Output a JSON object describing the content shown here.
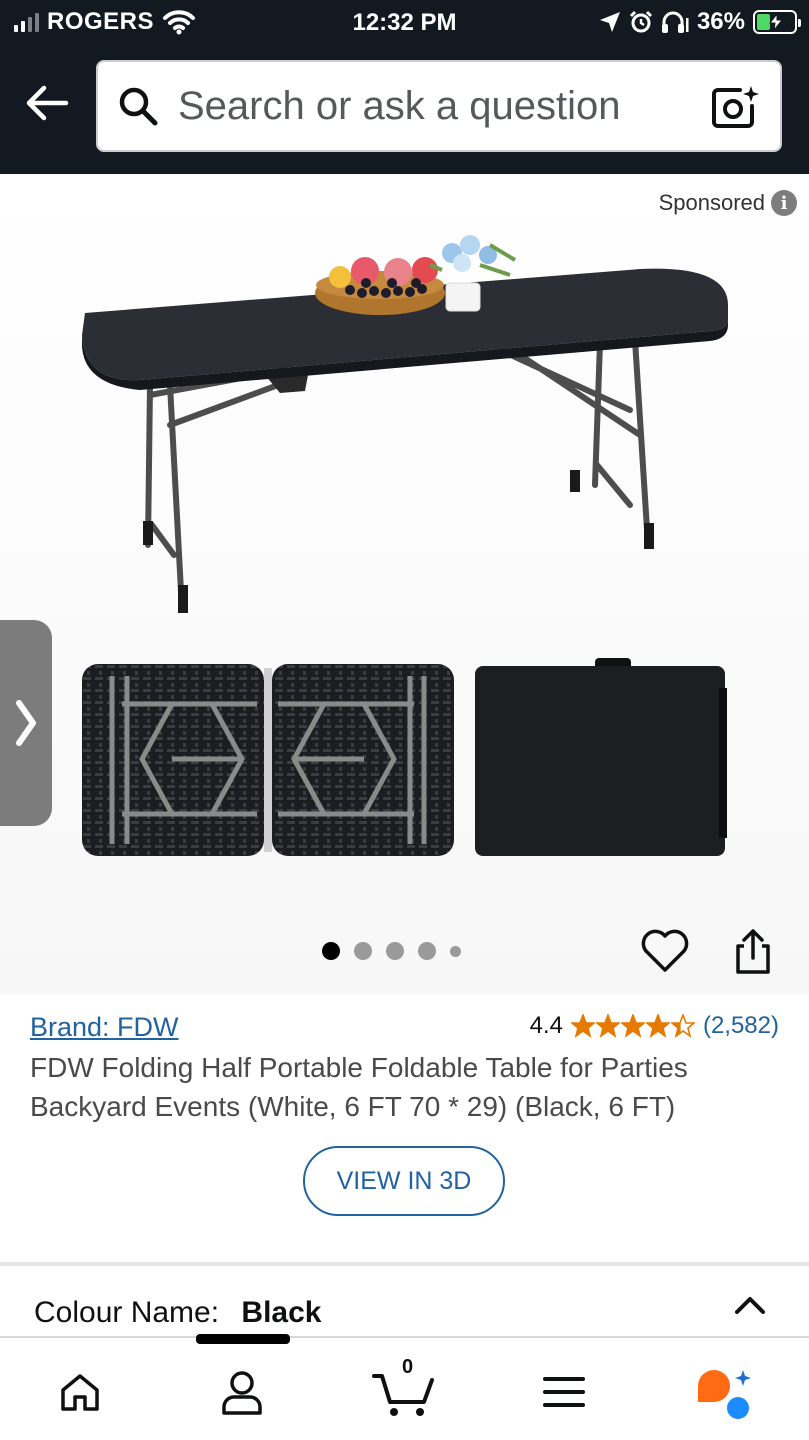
{
  "status_bar": {
    "carrier": "ROGERS",
    "time": "12:32 PM",
    "battery": "36%",
    "battery_level": 0.36,
    "icons": [
      "signal-icon",
      "wifi-icon",
      "location-icon",
      "alarm-icon",
      "headphones-icon",
      "battery-charging-icon"
    ]
  },
  "header": {
    "search_placeholder": "Search or ask a question",
    "icons": [
      "back-arrow-icon",
      "search-icon",
      "camera-search-icon"
    ]
  },
  "product": {
    "sponsored_label": "Sponsored",
    "image_count": 5,
    "active_image_index": 0,
    "brand_link": "Brand: FDW",
    "rating_value": "4.4",
    "rating_stars": 4.4,
    "rating_count": "(2,582)",
    "title": "FDW Folding Half Portable Foldable Table for Parties Backyard Events (White, 6 FT 70 * 29) (Black, 6 FT)",
    "view_3d_label": "VIEW IN 3D",
    "colour_label": "Colour Name:",
    "colour_value": "Black"
  },
  "bottom_nav": {
    "items": [
      "home-icon",
      "account-icon",
      "cart-icon",
      "menu-icon",
      "rufus-icon"
    ],
    "cart_count": "0",
    "active_index": 1
  },
  "colors": {
    "header_bg": "#131921",
    "link_blue": "#2162a1",
    "star_orange": "#e67a00",
    "battery_green": "#4cd964"
  }
}
